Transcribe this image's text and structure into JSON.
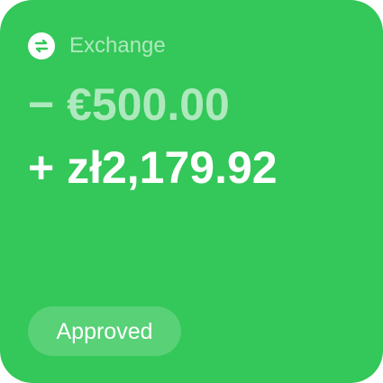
{
  "card": {
    "background_color": "#34C759",
    "header": {
      "icon": "exchange-arrows-icon",
      "label": "Exchange"
    },
    "amount_out": "− €500.00",
    "amount_in": "+ zł2,179.92",
    "status": "Approved"
  }
}
